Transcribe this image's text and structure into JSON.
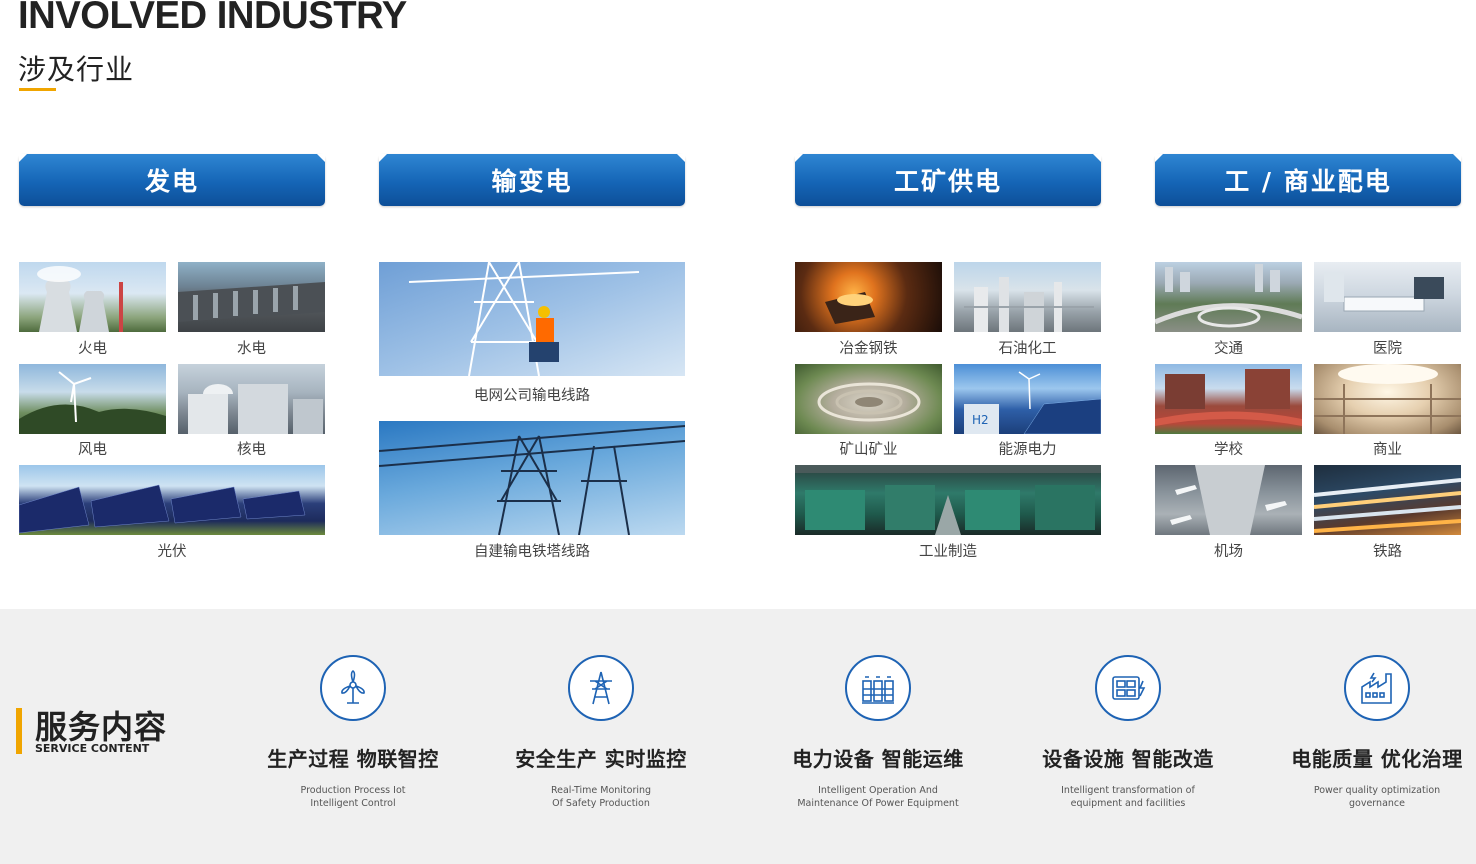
{
  "header": {
    "title_en": "INVOLVED INDUSTRY",
    "title_cn": "涉及行业"
  },
  "categories": [
    {
      "label": "发电",
      "items": [
        "火电",
        "水电",
        "风电",
        "核电",
        "光伏"
      ]
    },
    {
      "label": "输变电",
      "items": [
        "电网公司输电线路",
        "自建输电铁塔线路"
      ]
    },
    {
      "label": "工矿供电",
      "items": [
        "冶金钢铁",
        "石油化工",
        "矿山矿业",
        "能源电力",
        "工业制造"
      ]
    },
    {
      "label": "工 / 商业配电",
      "items": [
        "交通",
        "医院",
        "学校",
        "商业",
        "机场",
        "铁路"
      ]
    }
  ],
  "service": {
    "title_cn": "服务内容",
    "title_en": "SERVICE CONTENT",
    "items": [
      {
        "title": "生产过程 物联智控",
        "desc": "Production Process Iot\nIntelligent Control",
        "icon": "wind-turbine-icon"
      },
      {
        "title": "安全生产 实时监控",
        "desc": "Real-Time Monitoring\nOf Safety Production",
        "icon": "power-tower-icon"
      },
      {
        "title": "电力设备 智能运维",
        "desc": "Intelligent Operation And\nMaintenance Of Power Equipment",
        "icon": "battery-bank-icon"
      },
      {
        "title": "设备设施 智能改造",
        "desc": "Intelligent transformation of\nequipment and facilities",
        "icon": "control-panel-icon"
      },
      {
        "title": "电能质量 优化治理",
        "desc": "Power quality optimization\ngovernance",
        "icon": "factory-icon"
      }
    ]
  },
  "colors": {
    "accent": "#f0a500",
    "brand_blue": "#1565b6"
  }
}
